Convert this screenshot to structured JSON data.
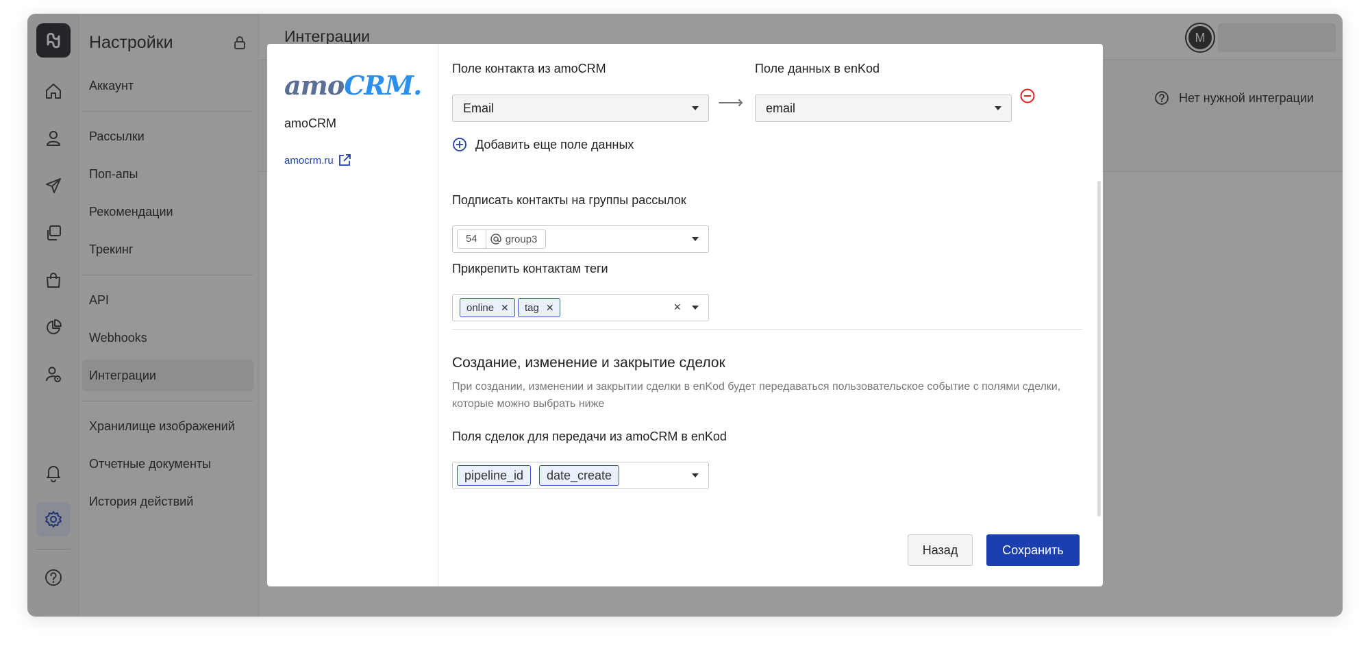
{
  "nav": {
    "title": "Настройки",
    "items": [
      "Аккаунт",
      "Рассылки",
      "Поп-апы",
      "Рекомендации",
      "Трекинг",
      "API",
      "Webhooks",
      "Интеграции",
      "Хранилище изображений",
      "Отчетные документы",
      "История действий"
    ],
    "active": "Интеграции"
  },
  "rail": {
    "icons": [
      "logo-icon",
      "home-icon",
      "user-icon",
      "send-icon",
      "copy-icon",
      "shopping-bag-icon",
      "pie-chart-icon",
      "user-settings-icon",
      "bell-icon",
      "gear-icon",
      "help-icon"
    ],
    "active": "gear-icon"
  },
  "main": {
    "title": "Интеграции",
    "avatar_letter": "M",
    "no_integration_label": "Нет нужной интеграции"
  },
  "modal": {
    "integration": {
      "logo_text_a": "amo",
      "logo_text_b": "CRM.",
      "name": "amoCRM",
      "link": "amocrm.ru"
    },
    "mapping": {
      "contact_field_label": "Поле контакта из amoCRM",
      "data_field_label": "Поле данных в enKod",
      "contact_field_value": "Email",
      "data_field_value": "email",
      "arrow": "⟶"
    },
    "add_field_label": "Добавить еще поле данных",
    "subscribe": {
      "label": "Подписать контакты на группы рассылок",
      "group_id": "54",
      "group_name": "group3"
    },
    "tags": {
      "label": "Прикрепить контактам теги",
      "items": [
        "online",
        "tag"
      ],
      "clear": "×"
    },
    "deals": {
      "title": "Создание, изменение и закрытие сделок",
      "description": "При создании, изменении и закрытии сделки в enKod будет передаваться пользовательское событие с полями сделки, которые можно выбрать ниже",
      "fields_label": "Поля сделок для передачи из amoCRM в enKod",
      "fields": [
        "pipeline_id",
        "date_create"
      ]
    },
    "buttons": {
      "back": "Назад",
      "save": "Сохранить"
    }
  },
  "colors": {
    "accent": "#1c3fb0",
    "danger": "#e02020",
    "overlay": "rgba(40,40,40,0.47)"
  }
}
